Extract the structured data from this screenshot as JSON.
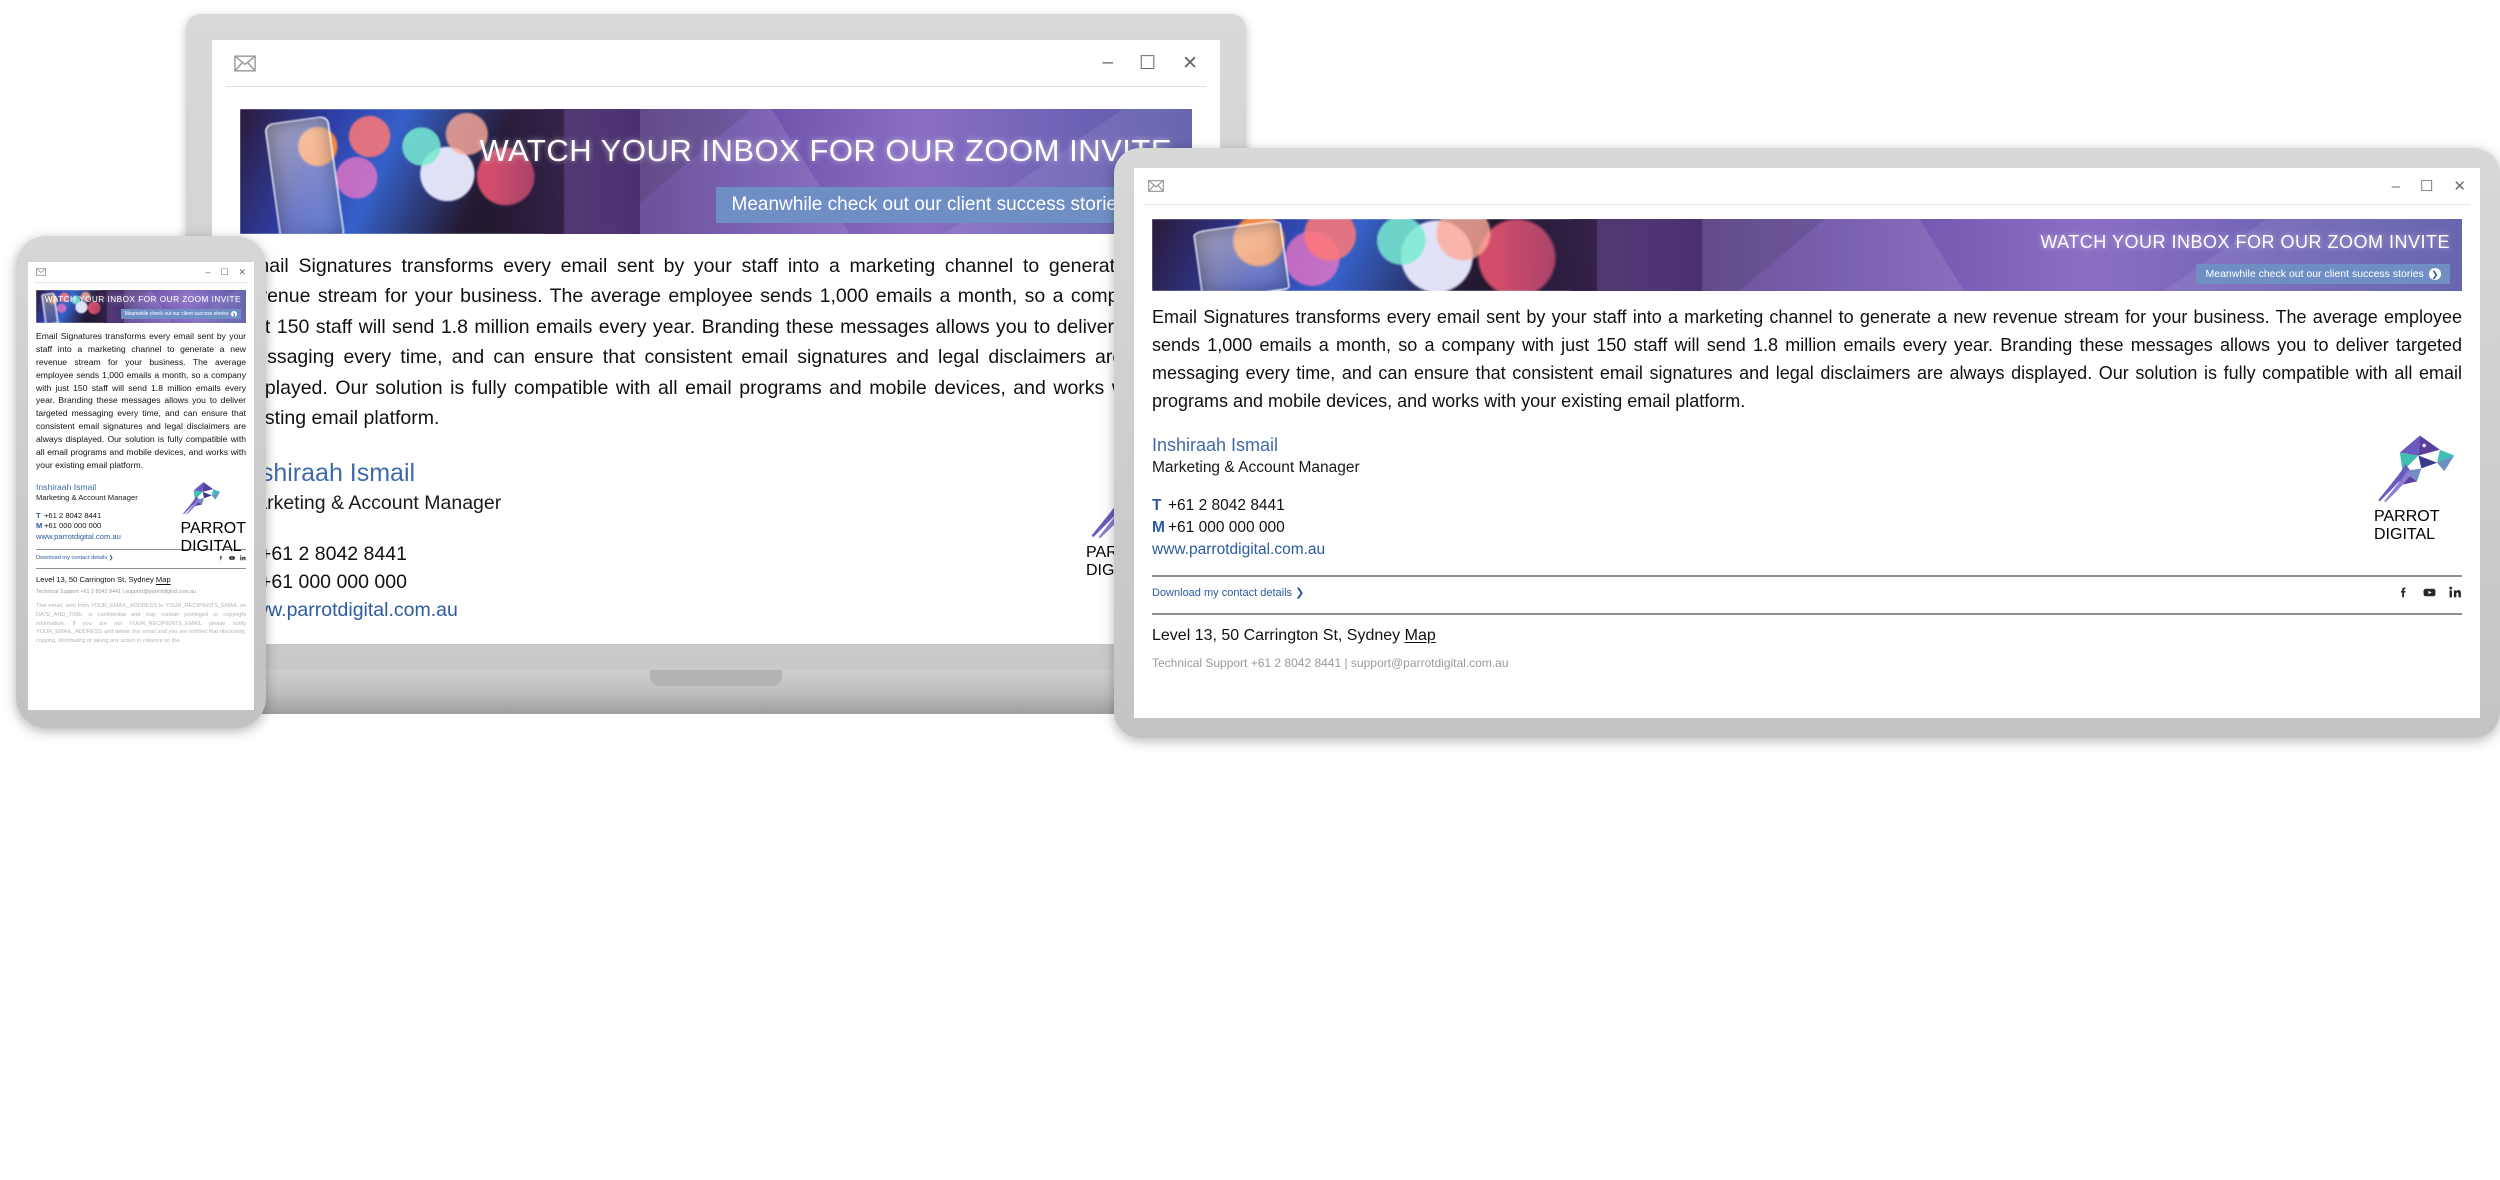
{
  "window": {
    "mail_icon": "envelope-icon",
    "minimize": "–",
    "maximize": "☐",
    "close": "✕"
  },
  "banner": {
    "headline": "WATCH YOUR INBOX FOR OUR ZOOM INVITE",
    "cta_label": "Meanwhile check out our client success stories",
    "cta_arrow": "❯",
    "cta_bg": "#6f8fc4",
    "photo_alt": "hand-holding-phone-photo"
  },
  "email": {
    "body": "Email Signatures transforms every email sent by your staff into a marketing channel to generate a new revenue stream for your business. The average employee sends 1,000 emails a month, so a company with just 150 staff will send 1.8 million emails every year. Branding these messages allows you to deliver targeted messaging every time, and can ensure that consistent email signatures and legal disclaimers are always displayed. Our solution is fully compatible with all email programs and mobile devices, and works with your existing email platform."
  },
  "signature": {
    "name": "Inshiraah Ismail",
    "name_color": "#3f6aa8",
    "role": "Marketing & Account Manager",
    "phone_label": "T",
    "phone_value": "+61 2 8042 8441",
    "mobile_label": "M",
    "mobile_value": "+61 000 000 000",
    "website": "www.parrotdigital.com.au",
    "link_color": "#2d5aa0",
    "download_label": "Download my contact details",
    "download_arrow": "❯",
    "address": "Level 13, 50 Carrington St, Sydney",
    "map_label": "Map",
    "tech_support": "Technical Support +61 2 8042 8441 | support@parrotdigital.com.au",
    "social": [
      {
        "name": "facebook-icon",
        "label": "f"
      },
      {
        "name": "youtube-icon",
        "label": "▶"
      },
      {
        "name": "linkedin-icon",
        "label": "in"
      }
    ]
  },
  "logo": {
    "word1": "PARROT",
    "word2": "DIGITAL",
    "colors": {
      "purple": "#5a3f9e",
      "teal": "#3fbfb0",
      "blue": "#6f8fc4",
      "deep": "#3b3a8c"
    }
  },
  "disclaimer": {
    "text": "This email, sent from YOUR_EMAIL_ADDRESS to YOUR_RECIPIENTS_EMAIL on DATE_AND_TIME, is confidential and may contain privileged or copyright information. If you are not YOUR_RECIPIENTS_EMAIL please notify YOUR_EMAIL_ADDRESS and delete this email and you are notified that disclosing, copying, distributing or taking any action in reliance on the"
  },
  "devices": {
    "laptop": "laptop-device",
    "phone": "phone-device",
    "tablet": "tablet-device"
  }
}
